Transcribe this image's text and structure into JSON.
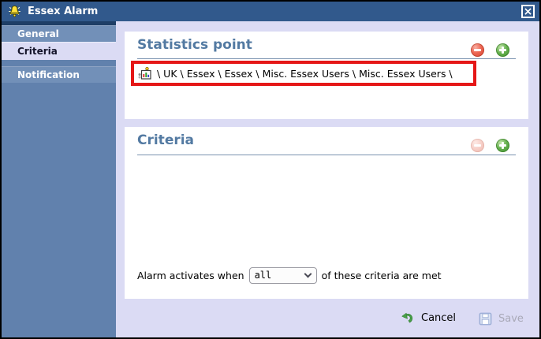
{
  "window": {
    "title": "Essex Alarm",
    "close_glyph": "×"
  },
  "sidebar": {
    "items": [
      {
        "label": "General",
        "selected": false
      },
      {
        "label": "Criteria",
        "selected": true
      },
      {
        "label": "Notification",
        "selected": false
      }
    ]
  },
  "sections": {
    "statistics": {
      "title": "Statistics point",
      "path": "\\ UK \\ Essex \\ Essex \\ Misc. Essex Users \\ Misc. Essex Users \\"
    },
    "criteria": {
      "title": "Criteria",
      "activation_text_before": "Alarm activates when",
      "activation_dropdown_value": "all",
      "activation_text_after": "of these criteria are met"
    }
  },
  "footer": {
    "cancel_label": "Cancel",
    "save_label": "Save"
  },
  "colors": {
    "titlebar": "#31598c",
    "sidebar": "#6181ad",
    "sidebar_item": "#7290b8",
    "selected_item_bg": "#dbdbf4",
    "content_bg": "#dbdbf4",
    "section_header_text": "#537aa2",
    "annotation_red": "#e51717",
    "remove_icon_red": "#ec6552",
    "add_icon_green": "#66b050",
    "disabled_text": "#a9a9b8"
  }
}
